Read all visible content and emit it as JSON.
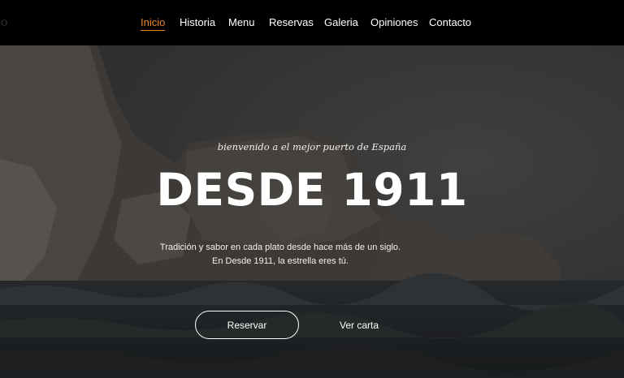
{
  "header": {
    "brand_text": "jo",
    "nav": [
      {
        "label": "Inicio",
        "active": true
      },
      {
        "label": "Historia"
      },
      {
        "label": "Menu"
      },
      {
        "label": "Reservas"
      },
      {
        "label": "Galeria"
      },
      {
        "label": "Opiniones"
      },
      {
        "label": "Contacto"
      }
    ]
  },
  "hero": {
    "kicker": "bienvenido a el mejor puerto de España",
    "headline": "DESDE 1911",
    "description_line1": "Tradición y sabor en cada plato desde hace más de un siglo.",
    "description_line2": "En Desde 1911, la estrella eres tú.",
    "primary_button": "Reservar",
    "secondary_button": "Ver carta"
  },
  "colors": {
    "nav_background": "#000000",
    "accent": "#e8862b",
    "text": "#ffffff"
  }
}
